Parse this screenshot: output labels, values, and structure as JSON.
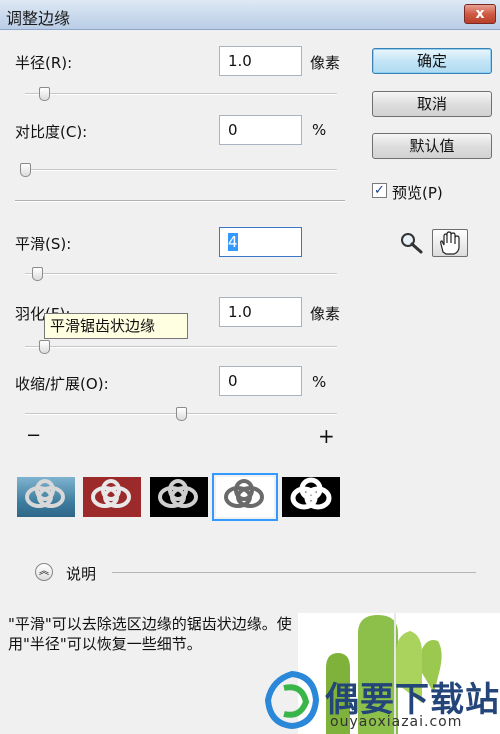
{
  "window": {
    "title": "调整边缘",
    "close_glyph": "x"
  },
  "fields": {
    "radius": {
      "label": "半径(R):",
      "value": "1.0",
      "unit": "像素",
      "slider": 0.06
    },
    "contrast": {
      "label": "对比度(C):",
      "value": "0",
      "unit": "%",
      "slider": 0.0
    },
    "smooth": {
      "label": "平滑(S):",
      "value": "4",
      "slider": 0.04
    },
    "feather": {
      "label": "羽化(F):",
      "value": "1.0",
      "unit": "像素",
      "slider": 0.06
    },
    "shrink": {
      "label": "收缩/扩展(O):",
      "value": "0",
      "unit": "%",
      "slider": 0.5,
      "minus": "−",
      "plus": "+"
    }
  },
  "buttons": {
    "ok": "确定",
    "cancel": "取消",
    "default": "默认值"
  },
  "preview": {
    "label": "预览(P)",
    "checked": true,
    "check_glyph": "✓"
  },
  "tools": {
    "zoom": "zoom-icon",
    "hand": "hand-icon"
  },
  "tooltip": "平滑锯齿状边缘",
  "views": [
    "standard",
    "quick-mask-red",
    "on-black",
    "on-white",
    "mask"
  ],
  "selected_view": 3,
  "description": {
    "toggle_glyph": "︽",
    "label": "说明",
    "text": "\"平滑\"可以去除选区边缘的锯齿状边缘。使用\"半径\"可以恢复一些细节。"
  },
  "watermark": {
    "name": "偶要下载站",
    "url": "ouyaoxiazai.com"
  },
  "colors": {
    "accent": "#3399ff",
    "tooltip_bg": "#ffffe1",
    "brand": "#24457a"
  }
}
